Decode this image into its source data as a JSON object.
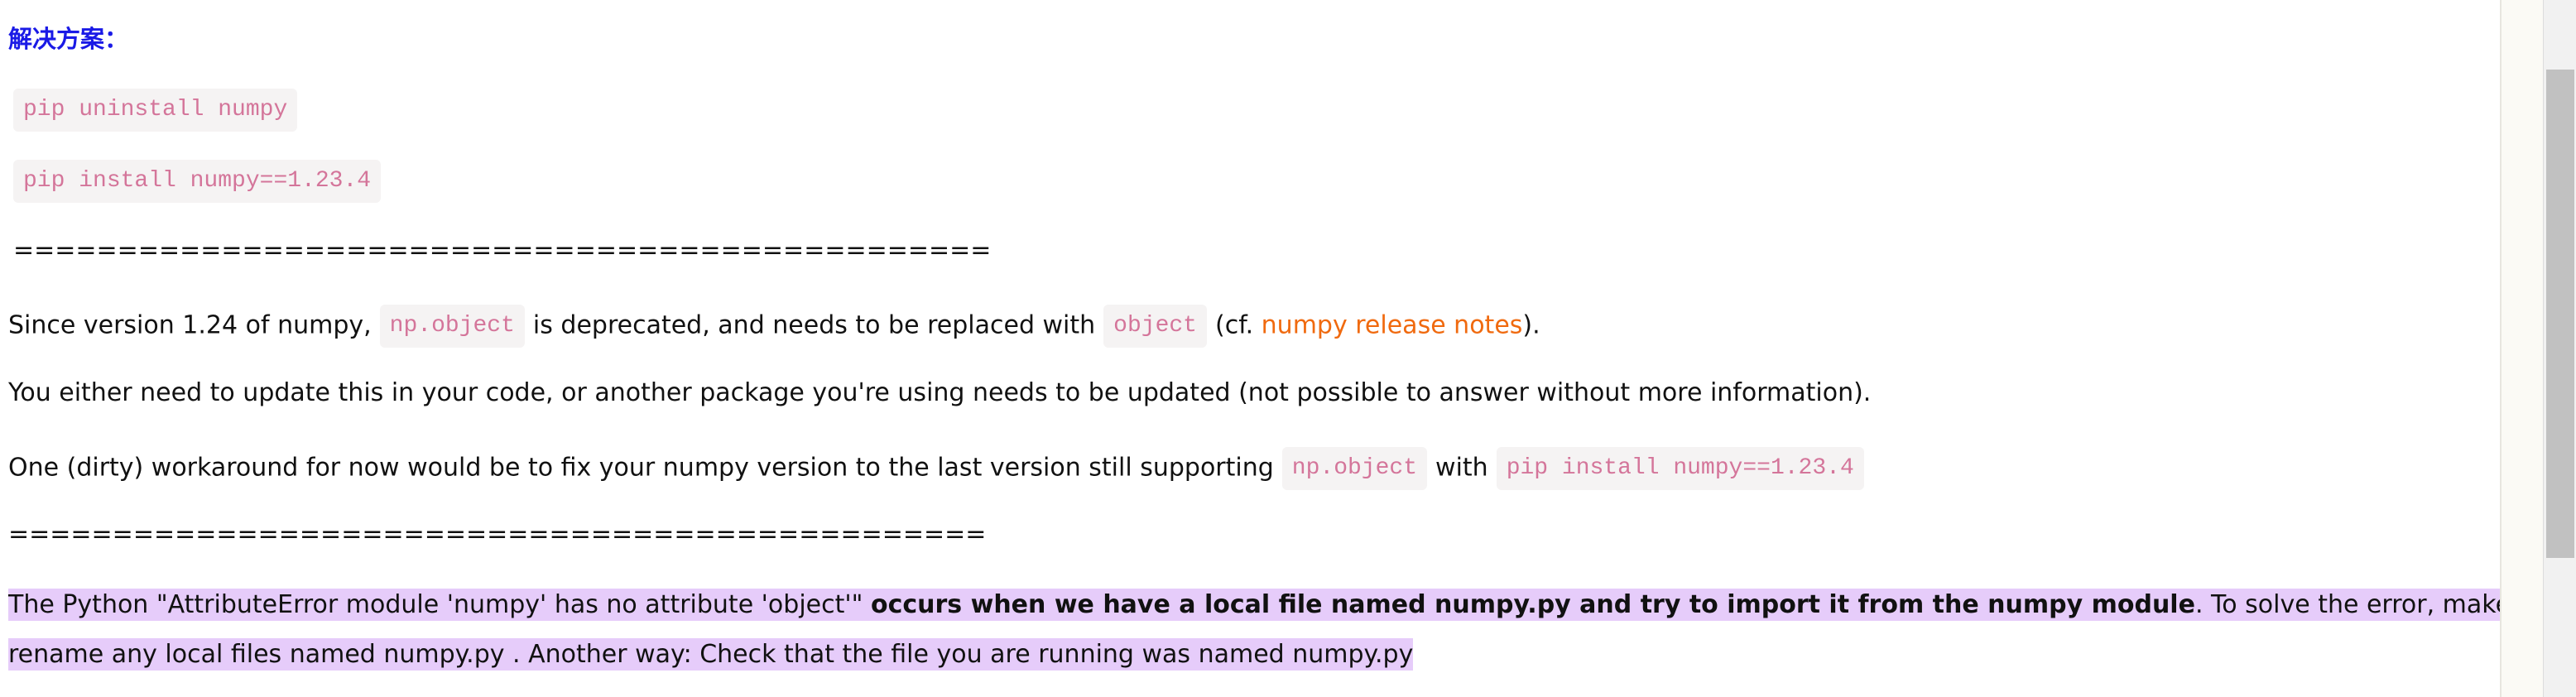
{
  "title": "解决方案：",
  "commands": {
    "uninstall": "pip uninstall numpy",
    "install": "pip install numpy==1.23.4"
  },
  "separator_1": "===============================================",
  "separator_2": "===============================================",
  "paragraph_1": {
    "before": "Since version 1.24 of numpy,",
    "code_1": "np.object",
    "middle": "is deprecated, and needs to be replaced with",
    "code_2": "object",
    "cf_open": "(cf.",
    "link": "numpy release notes",
    "cf_close": ")."
  },
  "paragraph_2": "You either need to update this in your code, or another package you're using needs to be updated (not possible to answer without more information).",
  "paragraph_3": {
    "before": "One (dirty) workaround for now would be to fix your numpy version to the last version still supporting",
    "code_1": "np.object",
    "middle": "with",
    "code_2": "pip install numpy==1.23.4"
  },
  "paragraph_4": {
    "part1": "The Python \"AttributeError module 'numpy' has no attribute 'object'\"",
    "bold": "occurs when we have a local file named numpy.py and try to import it from the numpy module",
    "part2": ". To solve the error, make sure to",
    "line2": "rename any local files named numpy.py . Another way: Check that the file you are running was named numpy.py"
  },
  "colors": {
    "title": "#1a1ae6",
    "link": "#f06a0f",
    "code_text": "#d4759a",
    "code_bg": "#f5f3f3",
    "highlight": "#e6ccfa"
  }
}
